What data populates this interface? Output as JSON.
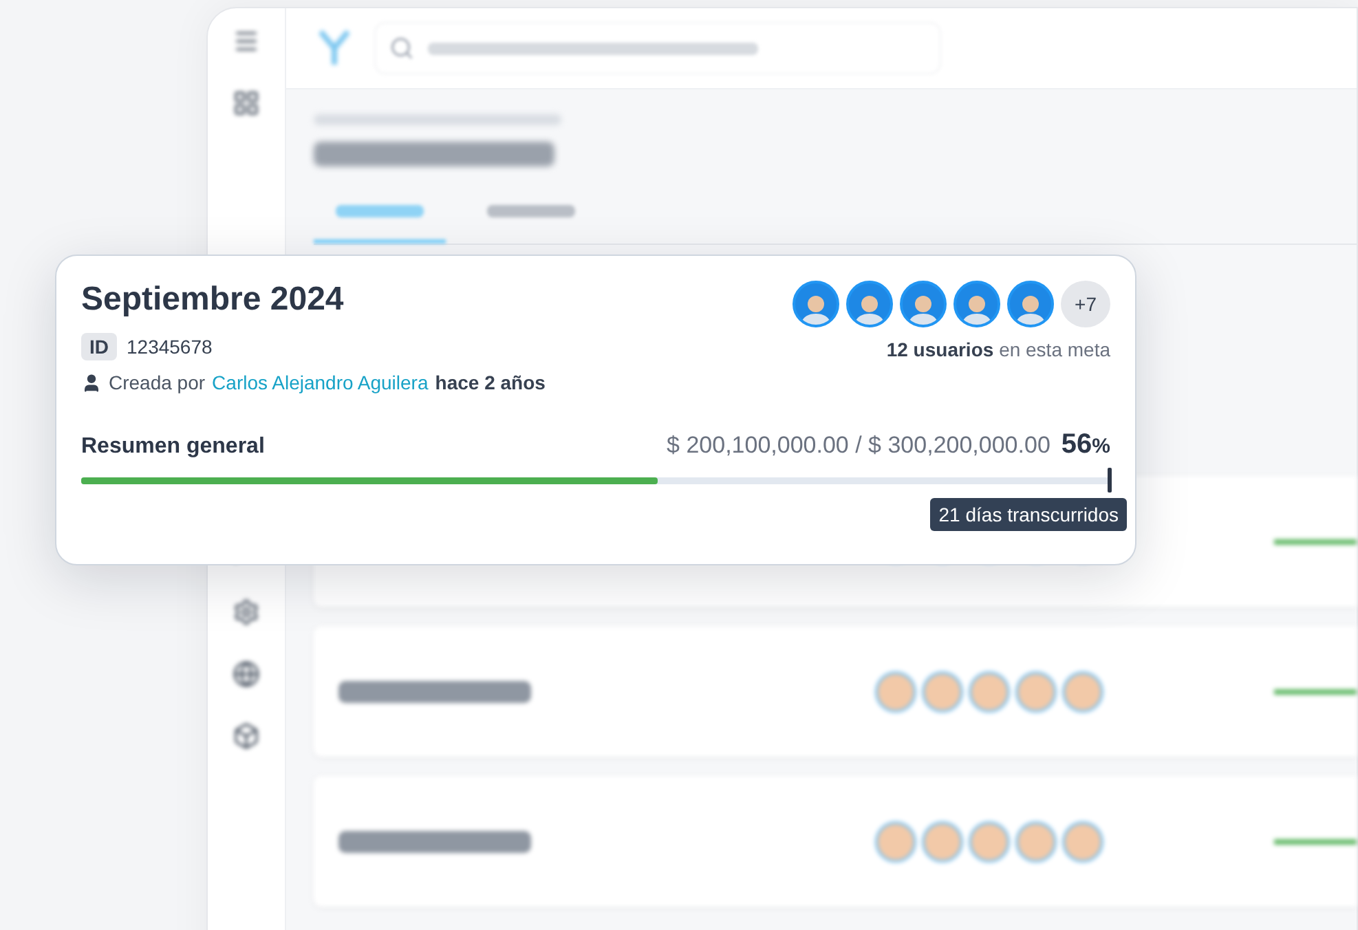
{
  "goal_card": {
    "title": "Septiembre 2024",
    "id_label": "ID",
    "id": "12345678",
    "created_by_label": "Creada por",
    "creator": "Carlos Alejandro Aguilera",
    "created_ago": "hace 2 años",
    "avatars": [
      {
        "kind": "photo"
      },
      {
        "kind": "photo"
      },
      {
        "kind": "photo"
      },
      {
        "kind": "photo"
      },
      {
        "kind": "photo"
      }
    ],
    "more": "+7",
    "users_count": "12 usuarios",
    "users_suffix": "en esta meta",
    "summary_label": "Resumen general",
    "amounts": "$ 200,100,000.00 / $ 300,200,000.00",
    "percent": "56",
    "percent_sign": "%",
    "progress": {
      "level": 0.56
    },
    "elapsed": "21 días transcurridos"
  }
}
